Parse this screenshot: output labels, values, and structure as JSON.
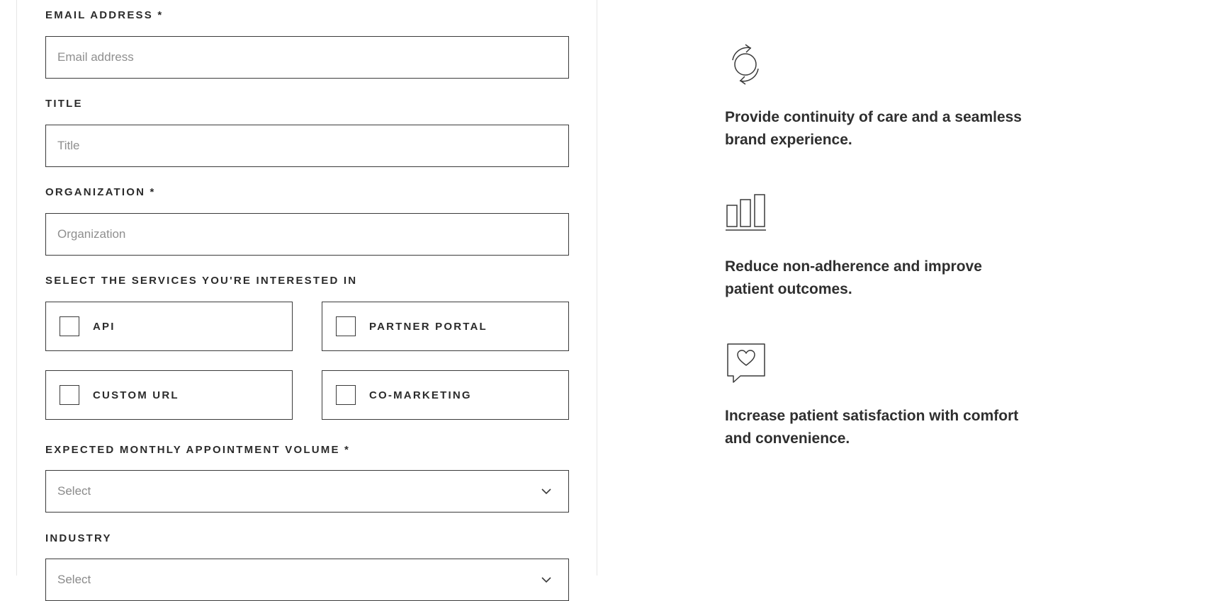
{
  "form": {
    "email": {
      "label": "EMAIL ADDRESS *",
      "placeholder": "Email address"
    },
    "title": {
      "label": "TITLE",
      "placeholder": "Title"
    },
    "organization": {
      "label": "ORGANIZATION *",
      "placeholder": "Organization"
    },
    "services": {
      "label": "SELECT THE SERVICES YOU'RE INTERESTED IN",
      "options": [
        {
          "label": "API",
          "checked": false
        },
        {
          "label": "PARTNER PORTAL",
          "checked": false
        },
        {
          "label": "CUSTOM URL",
          "checked": false
        },
        {
          "label": "CO-MARKETING",
          "checked": false
        }
      ]
    },
    "volume": {
      "label": "EXPECTED MONTHLY APPOINTMENT VOLUME *",
      "value": "Select",
      "icon": "chevron-down-icon"
    },
    "industry": {
      "label": "INDUSTRY",
      "value": "Select"
    }
  },
  "benefits": [
    {
      "icon": "refresh-cycle-icon",
      "text": "Provide continuity of care and a seamless brand experience."
    },
    {
      "icon": "bar-chart-icon",
      "text": "Reduce non-adherence and improve patient outcomes."
    },
    {
      "icon": "heart-speech-bubble-icon",
      "text": "Increase patient satisfaction with comfort and convenience."
    }
  ]
}
